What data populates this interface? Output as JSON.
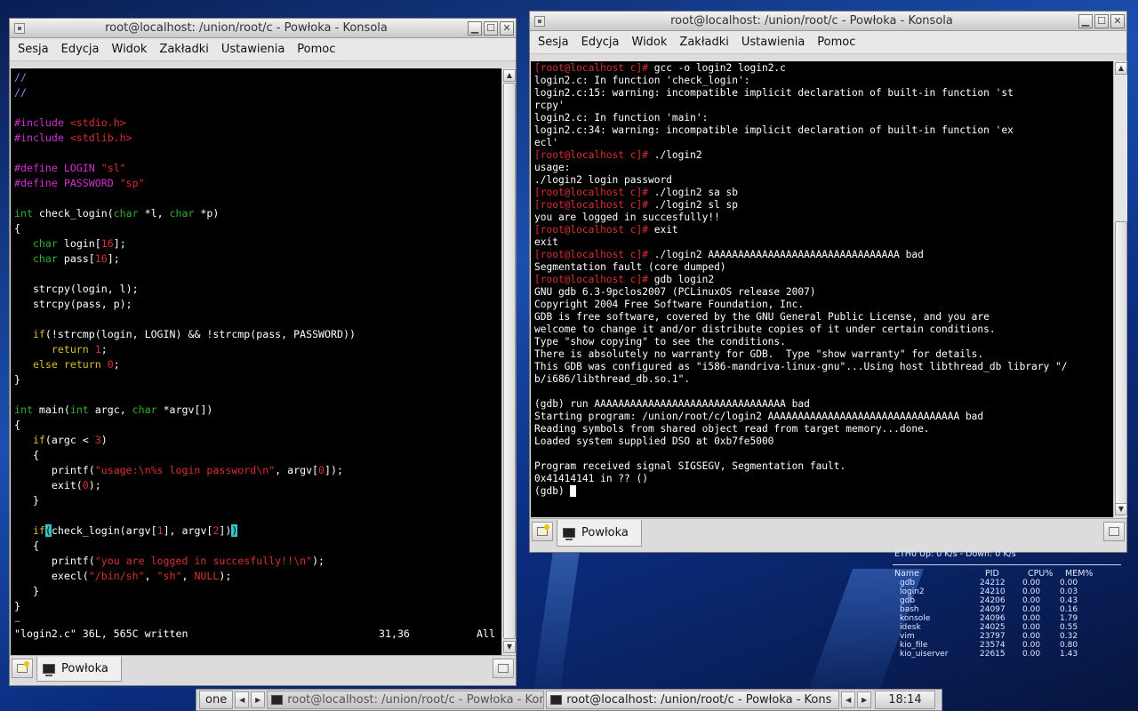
{
  "left_window": {
    "title": "root@localhost: /union/root/c - Powłoka - Konsola",
    "menu": [
      "Sesja",
      "Edycja",
      "Widok",
      "Zakładki",
      "Ustawienia",
      "Pomoc"
    ],
    "tab_label": "Powłoka",
    "status": {
      "file": "\"login2.c\" 36L, 565C written",
      "pos": "31,36",
      "scope": "All"
    },
    "code": [
      [
        [
          "//",
          "c-gray"
        ]
      ],
      [
        [
          "//",
          "c-gray"
        ]
      ],
      [
        [
          "",
          ""
        ]
      ],
      [
        [
          "#include ",
          "c-mag"
        ],
        [
          "<stdio.h>",
          "c-red"
        ]
      ],
      [
        [
          "#include ",
          "c-mag"
        ],
        [
          "<stdlib.h>",
          "c-red"
        ]
      ],
      [
        [
          "",
          ""
        ]
      ],
      [
        [
          "#define LOGIN ",
          "c-mag"
        ],
        [
          "\"sl\"",
          "c-red"
        ]
      ],
      [
        [
          "#define PASSWORD ",
          "c-mag"
        ],
        [
          "\"sp\"",
          "c-red"
        ]
      ],
      [
        [
          "",
          ""
        ]
      ],
      [
        [
          "int",
          "c-grn"
        ],
        [
          " check_login(",
          ""
        ],
        [
          "char",
          "c-grn"
        ],
        [
          " *l, ",
          ""
        ],
        [
          "char",
          "c-grn"
        ],
        [
          " *p)",
          ""
        ]
      ],
      [
        [
          "{",
          ""
        ]
      ],
      [
        [
          "   ",
          ""
        ],
        [
          "char",
          "c-grn"
        ],
        [
          " login[",
          ""
        ],
        [
          "16",
          "c-red"
        ],
        [
          "];",
          ""
        ]
      ],
      [
        [
          "   ",
          ""
        ],
        [
          "char",
          "c-grn"
        ],
        [
          " pass[",
          ""
        ],
        [
          "16",
          "c-red"
        ],
        [
          "];",
          ""
        ]
      ],
      [
        [
          "",
          ""
        ]
      ],
      [
        [
          "   strcpy(login, l);",
          ""
        ]
      ],
      [
        [
          "   strcpy(pass, p);",
          ""
        ]
      ],
      [
        [
          "",
          ""
        ]
      ],
      [
        [
          "   ",
          ""
        ],
        [
          "if",
          "c-yel"
        ],
        [
          "(!strcmp(login, LOGIN) && !strcmp(pass, PASSWORD))",
          ""
        ]
      ],
      [
        [
          "      ",
          ""
        ],
        [
          "return",
          "c-yel"
        ],
        [
          " ",
          ""
        ],
        [
          "1",
          "c-red"
        ],
        [
          ";",
          ""
        ]
      ],
      [
        [
          "   ",
          ""
        ],
        [
          "else",
          "c-yel"
        ],
        [
          " ",
          ""
        ],
        [
          "return",
          "c-yel"
        ],
        [
          " ",
          ""
        ],
        [
          "0",
          "c-red"
        ],
        [
          ";",
          ""
        ]
      ],
      [
        [
          "}",
          ""
        ]
      ],
      [
        [
          "",
          ""
        ]
      ],
      [
        [
          "int",
          "c-grn"
        ],
        [
          " main(",
          ""
        ],
        [
          "int",
          "c-grn"
        ],
        [
          " argc, ",
          ""
        ],
        [
          "char",
          "c-grn"
        ],
        [
          " *argv[])",
          ""
        ]
      ],
      [
        [
          "{",
          ""
        ]
      ],
      [
        [
          "   ",
          ""
        ],
        [
          "if",
          "c-yel"
        ],
        [
          "(argc < ",
          ""
        ],
        [
          "3",
          "c-red"
        ],
        [
          ")",
          ""
        ]
      ],
      [
        [
          "   {",
          ""
        ]
      ],
      [
        [
          "      printf(",
          ""
        ],
        [
          "\"usage:\\n%s login password\\n\"",
          "c-red"
        ],
        [
          ", argv[",
          ""
        ],
        [
          "0",
          "c-red"
        ],
        [
          "]);",
          ""
        ]
      ],
      [
        [
          "      exit(",
          ""
        ],
        [
          "0",
          "c-red"
        ],
        [
          ");",
          ""
        ]
      ],
      [
        [
          "   }",
          ""
        ]
      ],
      [
        [
          "",
          ""
        ]
      ],
      [
        [
          "   ",
          ""
        ],
        [
          "if",
          "c-yel"
        ],
        [
          "(",
          "bracket-hl"
        ],
        [
          "check_login(argv[",
          ""
        ],
        [
          "1",
          "c-red"
        ],
        [
          "], argv[",
          ""
        ],
        [
          "2",
          "c-red"
        ],
        [
          "])",
          ""
        ],
        [
          ")",
          "bracket-hl"
        ]
      ],
      [
        [
          "   {",
          ""
        ]
      ],
      [
        [
          "      printf(",
          ""
        ],
        [
          "\"you are logged in succesfully!!\\n\"",
          "c-red"
        ],
        [
          ");",
          ""
        ]
      ],
      [
        [
          "      execl(",
          ""
        ],
        [
          "\"/bin/sh\"",
          "c-red"
        ],
        [
          ", ",
          ""
        ],
        [
          "\"sh\"",
          "c-red"
        ],
        [
          ", ",
          ""
        ],
        [
          "NULL",
          "c-red"
        ],
        [
          ");",
          ""
        ]
      ],
      [
        [
          "   }",
          ""
        ]
      ],
      [
        [
          "}",
          ""
        ]
      ],
      [
        [
          "~",
          "c-gray"
        ]
      ]
    ]
  },
  "right_window": {
    "title": "root@localhost: /union/root/c - Powłoka - Konsola",
    "menu": [
      "Sesja",
      "Edycja",
      "Widok",
      "Zakładki",
      "Ustawienia",
      "Pomoc"
    ],
    "tab_label": "Powłoka",
    "lines": [
      [
        [
          "[root@localhost c]#",
          "prompt"
        ],
        [
          " gcc -o login2 login2.c",
          ""
        ]
      ],
      [
        [
          "login2.c: In function 'check_login':",
          ""
        ]
      ],
      [
        [
          "login2.c:15: warning: incompatible implicit declaration of built-in function 'st",
          ""
        ]
      ],
      [
        [
          "rcpy'",
          ""
        ]
      ],
      [
        [
          "login2.c: In function 'main':",
          ""
        ]
      ],
      [
        [
          "login2.c:34: warning: incompatible implicit declaration of built-in function 'ex",
          ""
        ]
      ],
      [
        [
          "ecl'",
          ""
        ]
      ],
      [
        [
          "[root@localhost c]#",
          "prompt"
        ],
        [
          " ./login2",
          ""
        ]
      ],
      [
        [
          "usage:",
          ""
        ]
      ],
      [
        [
          "./login2 login password",
          ""
        ]
      ],
      [
        [
          "[root@localhost c]#",
          "prompt"
        ],
        [
          " ./login2 sa sb",
          ""
        ]
      ],
      [
        [
          "[root@localhost c]#",
          "prompt"
        ],
        [
          " ./login2 sl sp",
          ""
        ]
      ],
      [
        [
          "you are logged in succesfully!!",
          ""
        ]
      ],
      [
        [
          "[root@localhost c]#",
          "prompt"
        ],
        [
          " exit",
          ""
        ]
      ],
      [
        [
          "exit",
          ""
        ]
      ],
      [
        [
          "[root@localhost c]#",
          "prompt"
        ],
        [
          " ./login2 AAAAAAAAAAAAAAAAAAAAAAAAAAAAAAAA bad",
          ""
        ]
      ],
      [
        [
          "Segmentation fault (core dumped)",
          ""
        ]
      ],
      [
        [
          "[root@localhost c]#",
          "prompt"
        ],
        [
          " gdb login2",
          ""
        ]
      ],
      [
        [
          "GNU gdb 6.3-9pclos2007 (PCLinuxOS release 2007)",
          ""
        ]
      ],
      [
        [
          "Copyright 2004 Free Software Foundation, Inc.",
          ""
        ]
      ],
      [
        [
          "GDB is free software, covered by the GNU General Public License, and you are",
          ""
        ]
      ],
      [
        [
          "welcome to change it and/or distribute copies of it under certain conditions.",
          ""
        ]
      ],
      [
        [
          "Type \"show copying\" to see the conditions.",
          ""
        ]
      ],
      [
        [
          "There is absolutely no warranty for GDB.  Type \"show warranty\" for details.",
          ""
        ]
      ],
      [
        [
          "This GDB was configured as \"i586-mandriva-linux-gnu\"...Using host libthread_db library \"/",
          ""
        ]
      ],
      [
        [
          "b/i686/libthread_db.so.1\".",
          ""
        ]
      ],
      [
        [
          "",
          ""
        ]
      ],
      [
        [
          "(gdb) run AAAAAAAAAAAAAAAAAAAAAAAAAAAAAAAA bad",
          ""
        ]
      ],
      [
        [
          "Starting program: /union/root/c/login2 AAAAAAAAAAAAAAAAAAAAAAAAAAAAAAAA bad",
          ""
        ]
      ],
      [
        [
          "Reading symbols from shared object read from target memory...done.",
          ""
        ]
      ],
      [
        [
          "Loaded system supplied DSO at 0xb7fe5000",
          ""
        ]
      ],
      [
        [
          "",
          ""
        ]
      ],
      [
        [
          "Program received signal SIGSEGV, Segmentation fault.",
          ""
        ]
      ],
      [
        [
          "0x41414141 in ?? ()",
          ""
        ]
      ],
      [
        [
          "(gdb) ",
          ""
        ],
        [
          " ",
          "cursor-block"
        ]
      ]
    ]
  },
  "sysmon": {
    "top": "ETH0 Up: 0       K/s - Down: 0      K/s",
    "headers": [
      "Name",
      "PID",
      "CPU%",
      "MEM%"
    ],
    "rows": [
      [
        "gdb",
        "24212",
        "0.00",
        "0.00"
      ],
      [
        "login2",
        "24210",
        "0.00",
        "0.03"
      ],
      [
        "gdb",
        "24206",
        "0.00",
        "0.43"
      ],
      [
        "bash",
        "24097",
        "0.00",
        "0.16"
      ],
      [
        "konsole",
        "24096",
        "0.00",
        "1.79"
      ],
      [
        "idesk",
        "24025",
        "0.00",
        "0.55"
      ],
      [
        "vim",
        "23797",
        "0.00",
        "0.32"
      ],
      [
        "kio_file",
        "23574",
        "0.00",
        "0.80"
      ],
      [
        "kio_uiserver",
        "22615",
        "0.00",
        "1.43"
      ]
    ]
  },
  "taskbar": {
    "desktop": "one",
    "task1": "root@localhost: /union/root/c - Powłoka - Kons",
    "task2": "root@localhost: /union/root/c - Powłoka - Kons",
    "clock": "18:14"
  }
}
